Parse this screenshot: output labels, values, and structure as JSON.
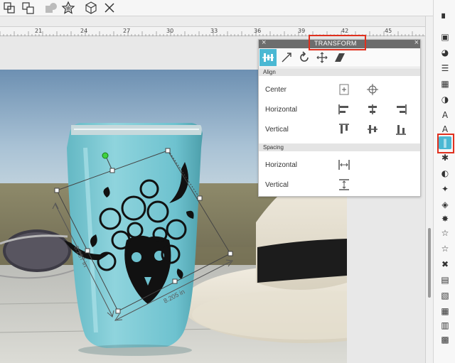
{
  "ruler": {
    "marks": [
      "21",
      "24",
      "27",
      "30",
      "33",
      "36",
      "39",
      "42",
      "45"
    ]
  },
  "panel": {
    "title": "TRANSFORM",
    "close_symbol": "×",
    "collapse_symbol": "×",
    "sections": {
      "align": "Align",
      "spacing": "Spacing"
    },
    "rows": {
      "center": "Center",
      "horizontal": "Horizontal",
      "vertical": "Vertical",
      "spacing_horizontal": "Horizontal",
      "spacing_vertical": "Vertical"
    }
  },
  "dimensions": {
    "height": "8.287 in",
    "width": "8.205 in"
  },
  "colors": {
    "accent": "#4ab8d3",
    "highlight": "#e0301e",
    "panel_title_bar": "#6d6d6d"
  },
  "icons": {
    "toolbar": [
      "group-icon",
      "ungroup-icon",
      "compound-path-icon",
      "star-shape-icon",
      "box-icon",
      "close-icon"
    ],
    "tabs": [
      "align-tab-icon",
      "scale-tab-icon",
      "rotate-tab-icon",
      "move-tab-icon",
      "shear-tab-icon"
    ],
    "side": [
      "page-setup-icon",
      "send-panel-icon",
      "color-palette-icon",
      "line-style-icon",
      "fill-icon",
      "contrast-icon",
      "text-icon",
      "text-style-icon",
      "transform-icon",
      "replicate-icon",
      "modify-icon",
      "knife-icon",
      "trace-icon",
      "offset-icon",
      "library-icon",
      "star-icon",
      "cross-icon",
      "layers-icon",
      "print-cut-icon",
      "grid-icon",
      "pixscan-icon",
      "registration-icon"
    ]
  }
}
